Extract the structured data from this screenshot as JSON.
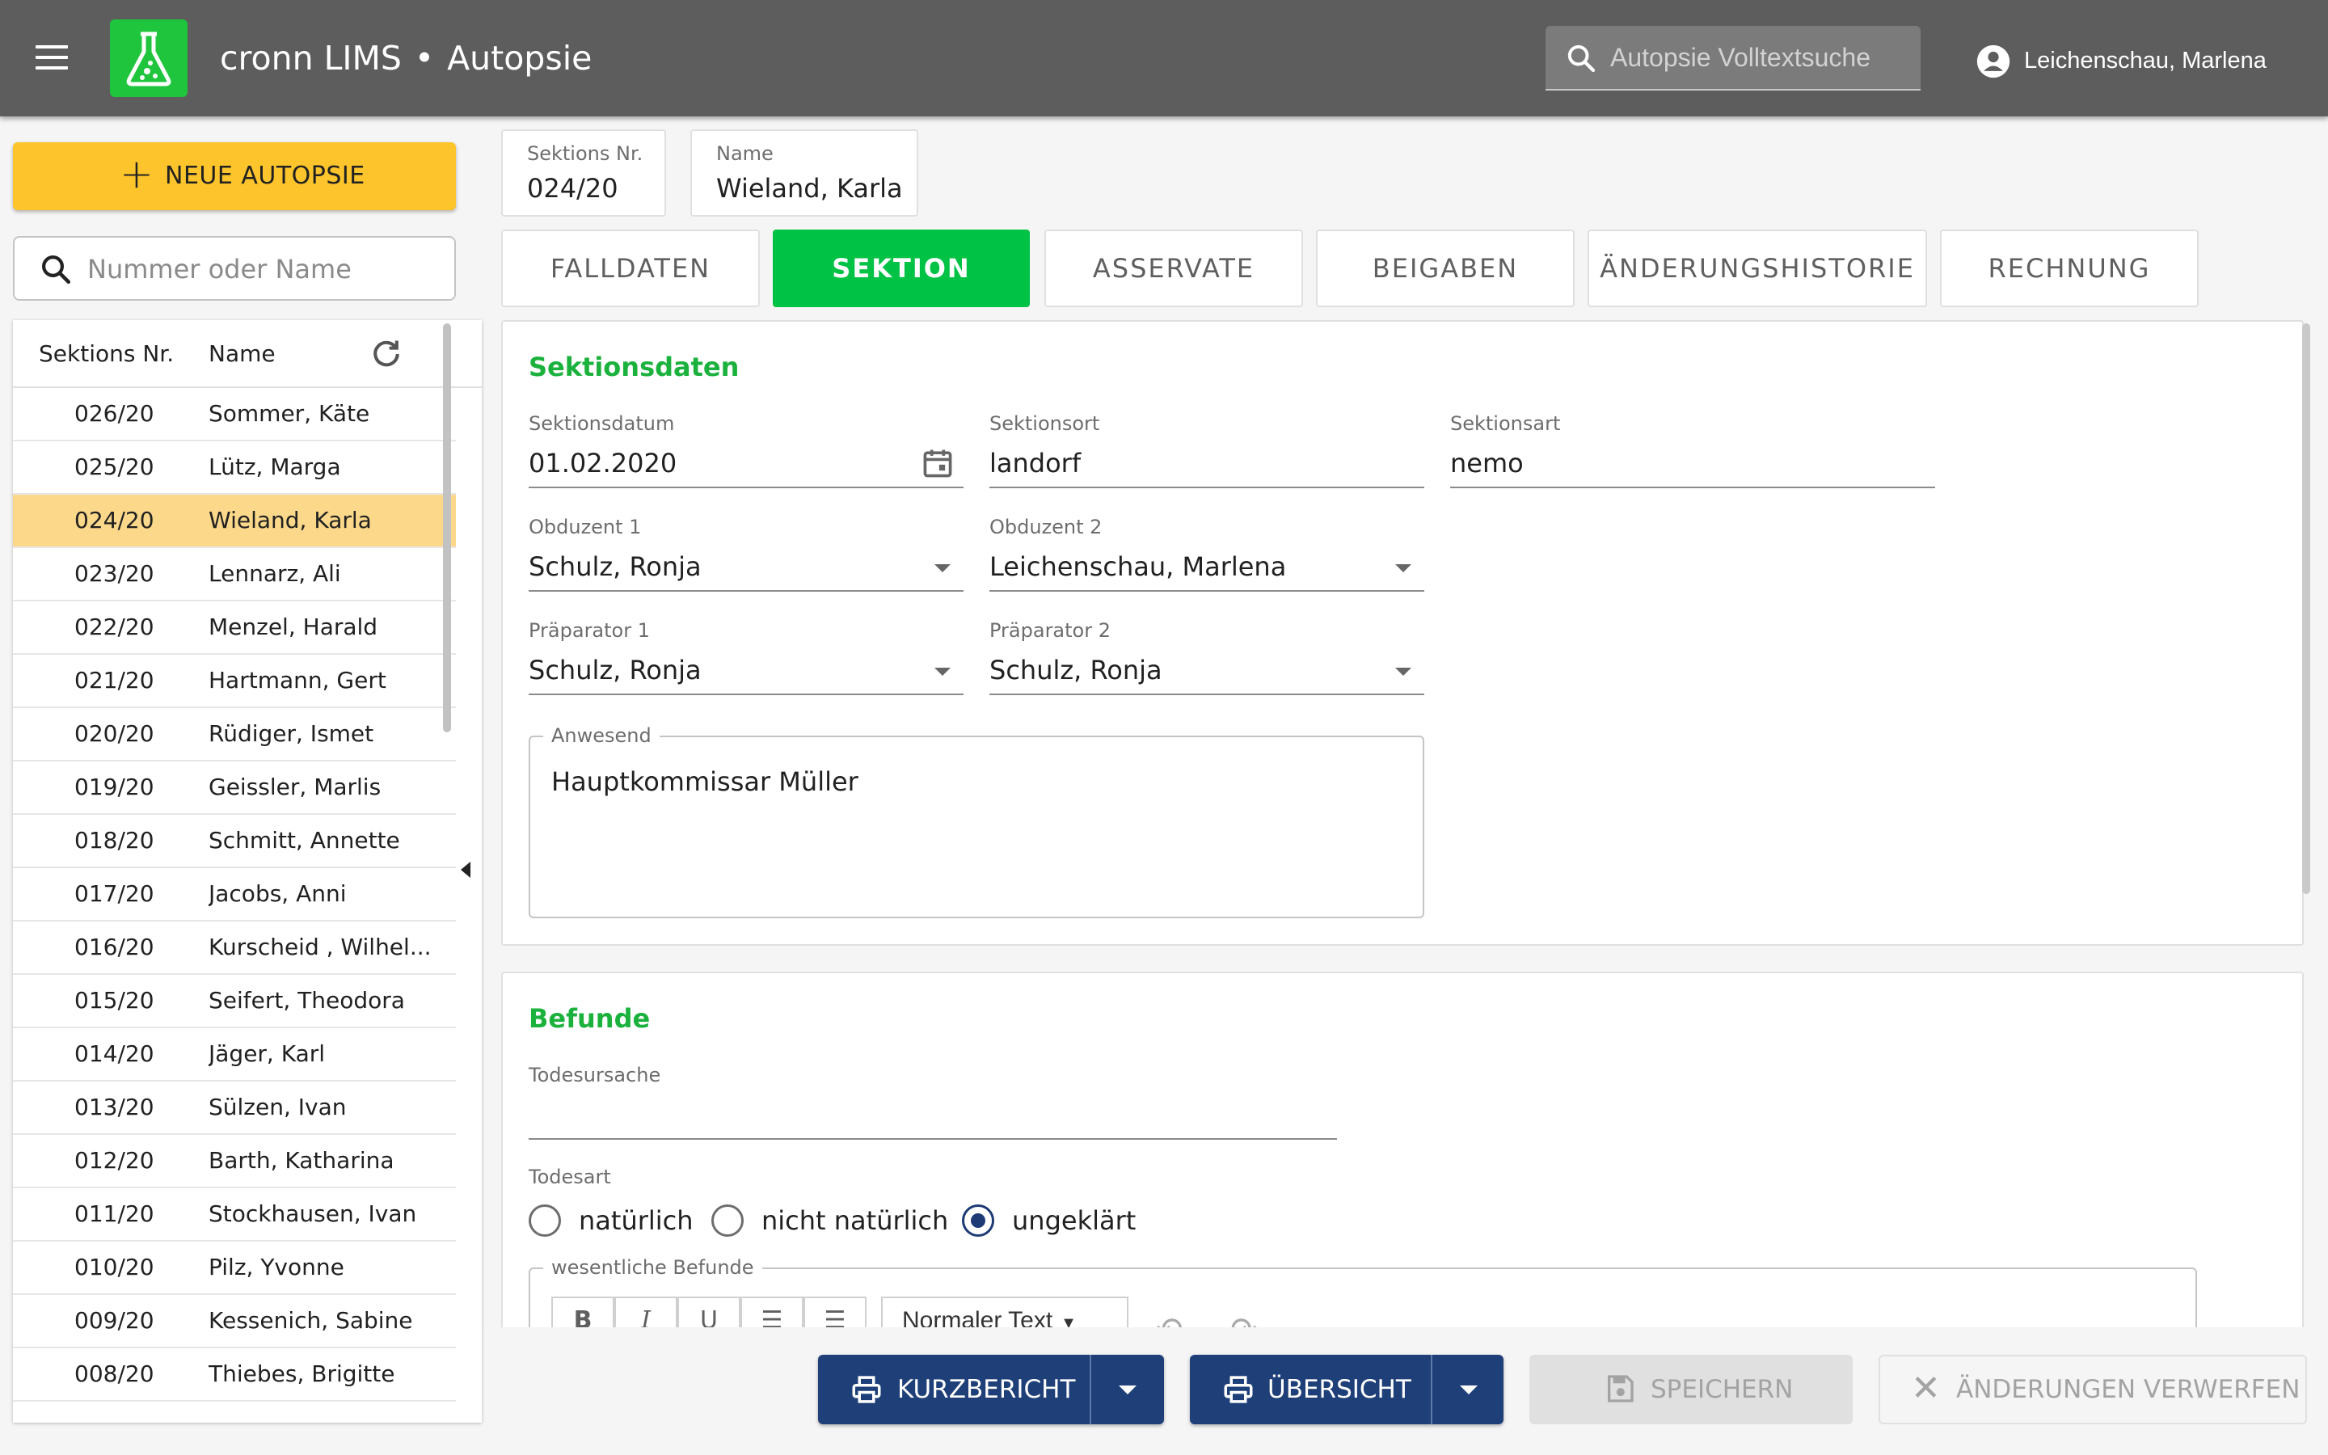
{
  "app": {
    "name": "cronn LIMS",
    "separator": "•",
    "module": "Autopsie"
  },
  "header": {
    "search_placeholder": "Autopsie Volltextsuche",
    "user_name": "Leichenschau, Marlena"
  },
  "sidebar": {
    "new_button": "NEUE AUTOPSIE",
    "search_placeholder": "Nummer oder Name",
    "col_nr": "Sektions Nr.",
    "col_name": "Name",
    "rows": [
      {
        "nr": "026/20",
        "name": "Sommer, Käte"
      },
      {
        "nr": "025/20",
        "name": "Lütz, Marga"
      },
      {
        "nr": "024/20",
        "name": "Wieland, Karla"
      },
      {
        "nr": "023/20",
        "name": "Lennarz, Ali"
      },
      {
        "nr": "022/20",
        "name": "Menzel, Harald"
      },
      {
        "nr": "021/20",
        "name": "Hartmann, Gert"
      },
      {
        "nr": "020/20",
        "name": "Rüdiger, Ismet"
      },
      {
        "nr": "019/20",
        "name": "Geissler, Marlis"
      },
      {
        "nr": "018/20",
        "name": "Schmitt, Annette"
      },
      {
        "nr": "017/20",
        "name": "Jacobs, Anni"
      },
      {
        "nr": "016/20",
        "name": "Kurscheid , Wilhel..."
      },
      {
        "nr": "015/20",
        "name": "Seifert, Theodora"
      },
      {
        "nr": "014/20",
        "name": "Jäger, Karl"
      },
      {
        "nr": "013/20",
        "name": "Sülzen, Ivan"
      },
      {
        "nr": "012/20",
        "name": "Barth, Katharina"
      },
      {
        "nr": "011/20",
        "name": "Stockhausen, Ivan"
      },
      {
        "nr": "010/20",
        "name": "Pilz, Yvonne"
      },
      {
        "nr": "009/20",
        "name": "Kessenich, Sabine"
      },
      {
        "nr": "008/20",
        "name": "Thiebes, Brigitte"
      }
    ],
    "selected_index": 2
  },
  "record": {
    "nr_label": "Sektions Nr.",
    "nr_value": "024/20",
    "name_label": "Name",
    "name_value": "Wieland, Karla"
  },
  "tabs": [
    "FALLDATEN",
    "SEKTION",
    "ASSERVATE",
    "BEIGABEN",
    "ÄNDERUNGSHISTORIE",
    "RECHNUNG"
  ],
  "active_tab": "SEKTION",
  "sektionsdaten": {
    "title": "Sektionsdaten",
    "datum_label": "Sektionsdatum",
    "datum_value": "01.02.2020",
    "ort_label": "Sektionsort",
    "ort_value": "landorf",
    "art_label": "Sektionsart",
    "art_value": "nemo",
    "obduzent1_label": "Obduzent 1",
    "obduzent1_value": "Schulz, Ronja",
    "obduzent2_label": "Obduzent 2",
    "obduzent2_value": "Leichenschau, Marlena",
    "praeparator1_label": "Präparator 1",
    "praeparator1_value": "Schulz, Ronja",
    "praeparator2_label": "Präparator 2",
    "praeparator2_value": "Schulz, Ronja",
    "anwesend_label": "Anwesend",
    "anwesend_value": "Hauptkommissar Müller"
  },
  "befunde": {
    "title": "Befunde",
    "todesursache_label": "Todesursache",
    "todesursache_value": "",
    "todesart_label": "Todesart",
    "todesart_options": [
      "natürlich",
      "nicht natürlich",
      "ungeklärt"
    ],
    "todesart_selected": "ungeklärt",
    "wesentliche_label": "wesentliche Befunde",
    "editor_format": "Normaler Text"
  },
  "footer": {
    "kurzbericht": "KURZBERICHT",
    "uebersicht": "ÜBERSICHT",
    "speichern": "SPEICHERN",
    "verwerfen": "ÄNDERUNGEN VERWERFEN"
  },
  "colors": {
    "topbar": "#5d5d5d",
    "logo": "#1fc53d",
    "accent_yellow": "#fdc52b",
    "active_tab": "#00c244",
    "section_title": "#1bb13d",
    "primary_button": "#1e3f78",
    "selected_row": "#fbd88a"
  }
}
